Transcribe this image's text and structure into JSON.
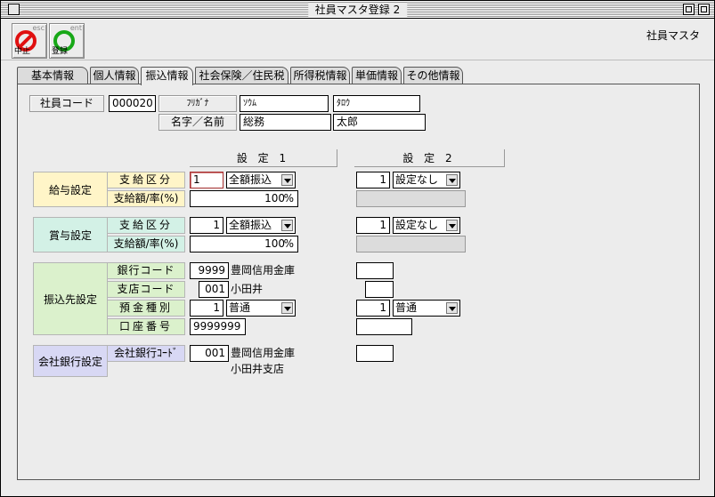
{
  "window": {
    "title": "社員マスタ登録 2"
  },
  "toolbar": {
    "cancel": {
      "label": "中止",
      "key": "esc"
    },
    "register": {
      "label": "登録",
      "key": "ent"
    },
    "screen_name": "社員マスタ"
  },
  "tabs": [
    {
      "label": "基本情報",
      "active": false
    },
    {
      "label": "個人情報",
      "active": false
    },
    {
      "label": "振込情報",
      "active": true
    },
    {
      "label": "社会保険／住民税",
      "active": false
    },
    {
      "label": "所得税情報",
      "active": false
    },
    {
      "label": "単価情報",
      "active": false
    },
    {
      "label": "その他情報",
      "active": false
    }
  ],
  "employee": {
    "code_label": "社員コード",
    "code": "000020",
    "furigana_label": "ﾌﾘｶﾞﾅ",
    "furigana_last": "ｿｳﾑ",
    "furigana_first": "ﾀﾛｳ",
    "name_label": "名字／名前",
    "last_name": "総務",
    "first_name": "太郎"
  },
  "columns": {
    "setting1": "設 定 1",
    "setting2": "設 定 2"
  },
  "salary": {
    "title": "給与設定",
    "kubun_label": "支給区分",
    "rate_label": "支給額/率(%)",
    "s1_kubun_code": "1",
    "s1_kubun": "全額振込",
    "s1_rate": "100",
    "s2_kubun_code": "1",
    "s2_kubun": "設定なし",
    "rate_unit": "%"
  },
  "bonus": {
    "title": "賞与設定",
    "kubun_label": "支給区分",
    "rate_label": "支給額/率(%)",
    "s1_kubun_code": "1",
    "s1_kubun": "全額振込",
    "s1_rate": "100",
    "s2_kubun_code": "1",
    "s2_kubun": "設定なし",
    "rate_unit": "%"
  },
  "transfer": {
    "title": "振込先設定",
    "bank_label": "銀行コード",
    "branch_label": "支店コード",
    "type_label": "預金種別",
    "account_label": "口座番号",
    "s1_bank_code": "9999",
    "s1_bank_name": "豊岡信用金庫",
    "s1_branch_code": "001",
    "s1_branch_name": "小田井",
    "s1_type_code": "1",
    "s1_type": "普通",
    "s1_account": "9999999",
    "s2_type_code": "1",
    "s2_type": "普通"
  },
  "company_bank": {
    "title": "会社銀行設定",
    "label": "会社銀行ｺｰﾄﾞ",
    "code": "001",
    "bank_name": "豊岡信用金庫",
    "branch_name": "小田井支店"
  }
}
